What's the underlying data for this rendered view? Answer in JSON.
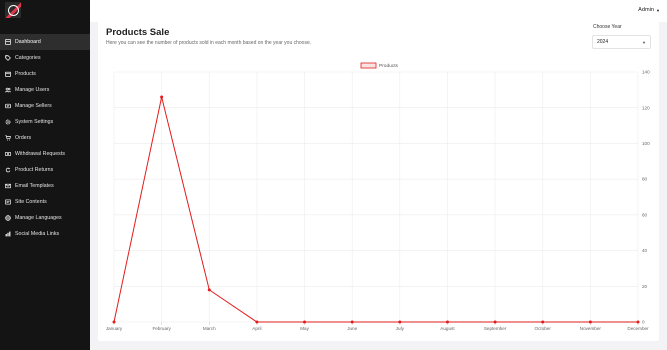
{
  "sidebar": {
    "items": [
      {
        "label": "Dashboard",
        "icon": "dashboard-icon",
        "active": true
      },
      {
        "label": "Categories",
        "icon": "tag-icon"
      },
      {
        "label": "Products",
        "icon": "box-icon"
      },
      {
        "label": "Manage Users",
        "icon": "users-icon"
      },
      {
        "label": "Manage Sellers",
        "icon": "id-card-icon"
      },
      {
        "label": "System Settings",
        "icon": "gear-icon"
      },
      {
        "label": "Orders",
        "icon": "cart-icon"
      },
      {
        "label": "Withdrawal Requests",
        "icon": "money-icon"
      },
      {
        "label": "Product Returns",
        "icon": "return-icon"
      },
      {
        "label": "Email Templates",
        "icon": "envelope-icon"
      },
      {
        "label": "Site Contents",
        "icon": "document-icon"
      },
      {
        "label": "Manage Languages",
        "icon": "globe-icon"
      },
      {
        "label": "Social Media Links",
        "icon": "share-icon"
      }
    ]
  },
  "header": {
    "user": "Admin"
  },
  "main": {
    "title": "Products Sale",
    "subtitle": "Here you can see the number of products sold in each month based on the year you choose.",
    "year_label": "Choose Year",
    "year_value": "2024"
  },
  "colors": {
    "accent": "#e0354b",
    "line": "#e21b1b",
    "sidebar": "#141414"
  },
  "chart_data": {
    "type": "line",
    "categories": [
      "January",
      "February",
      "March",
      "April",
      "May",
      "June",
      "July",
      "August",
      "September",
      "October",
      "November",
      "December"
    ],
    "series": [
      {
        "name": "Products",
        "values": [
          0,
          126,
          18,
          0,
          0,
          0,
          0,
          0,
          0,
          0,
          0,
          0
        ],
        "color": "#e21b1b"
      }
    ],
    "ylim": [
      0,
      140
    ],
    "yticks": [
      0,
      20,
      40,
      60,
      80,
      100,
      120,
      140
    ],
    "y_axis_side": "right",
    "grid": true,
    "legend": "top-center"
  }
}
